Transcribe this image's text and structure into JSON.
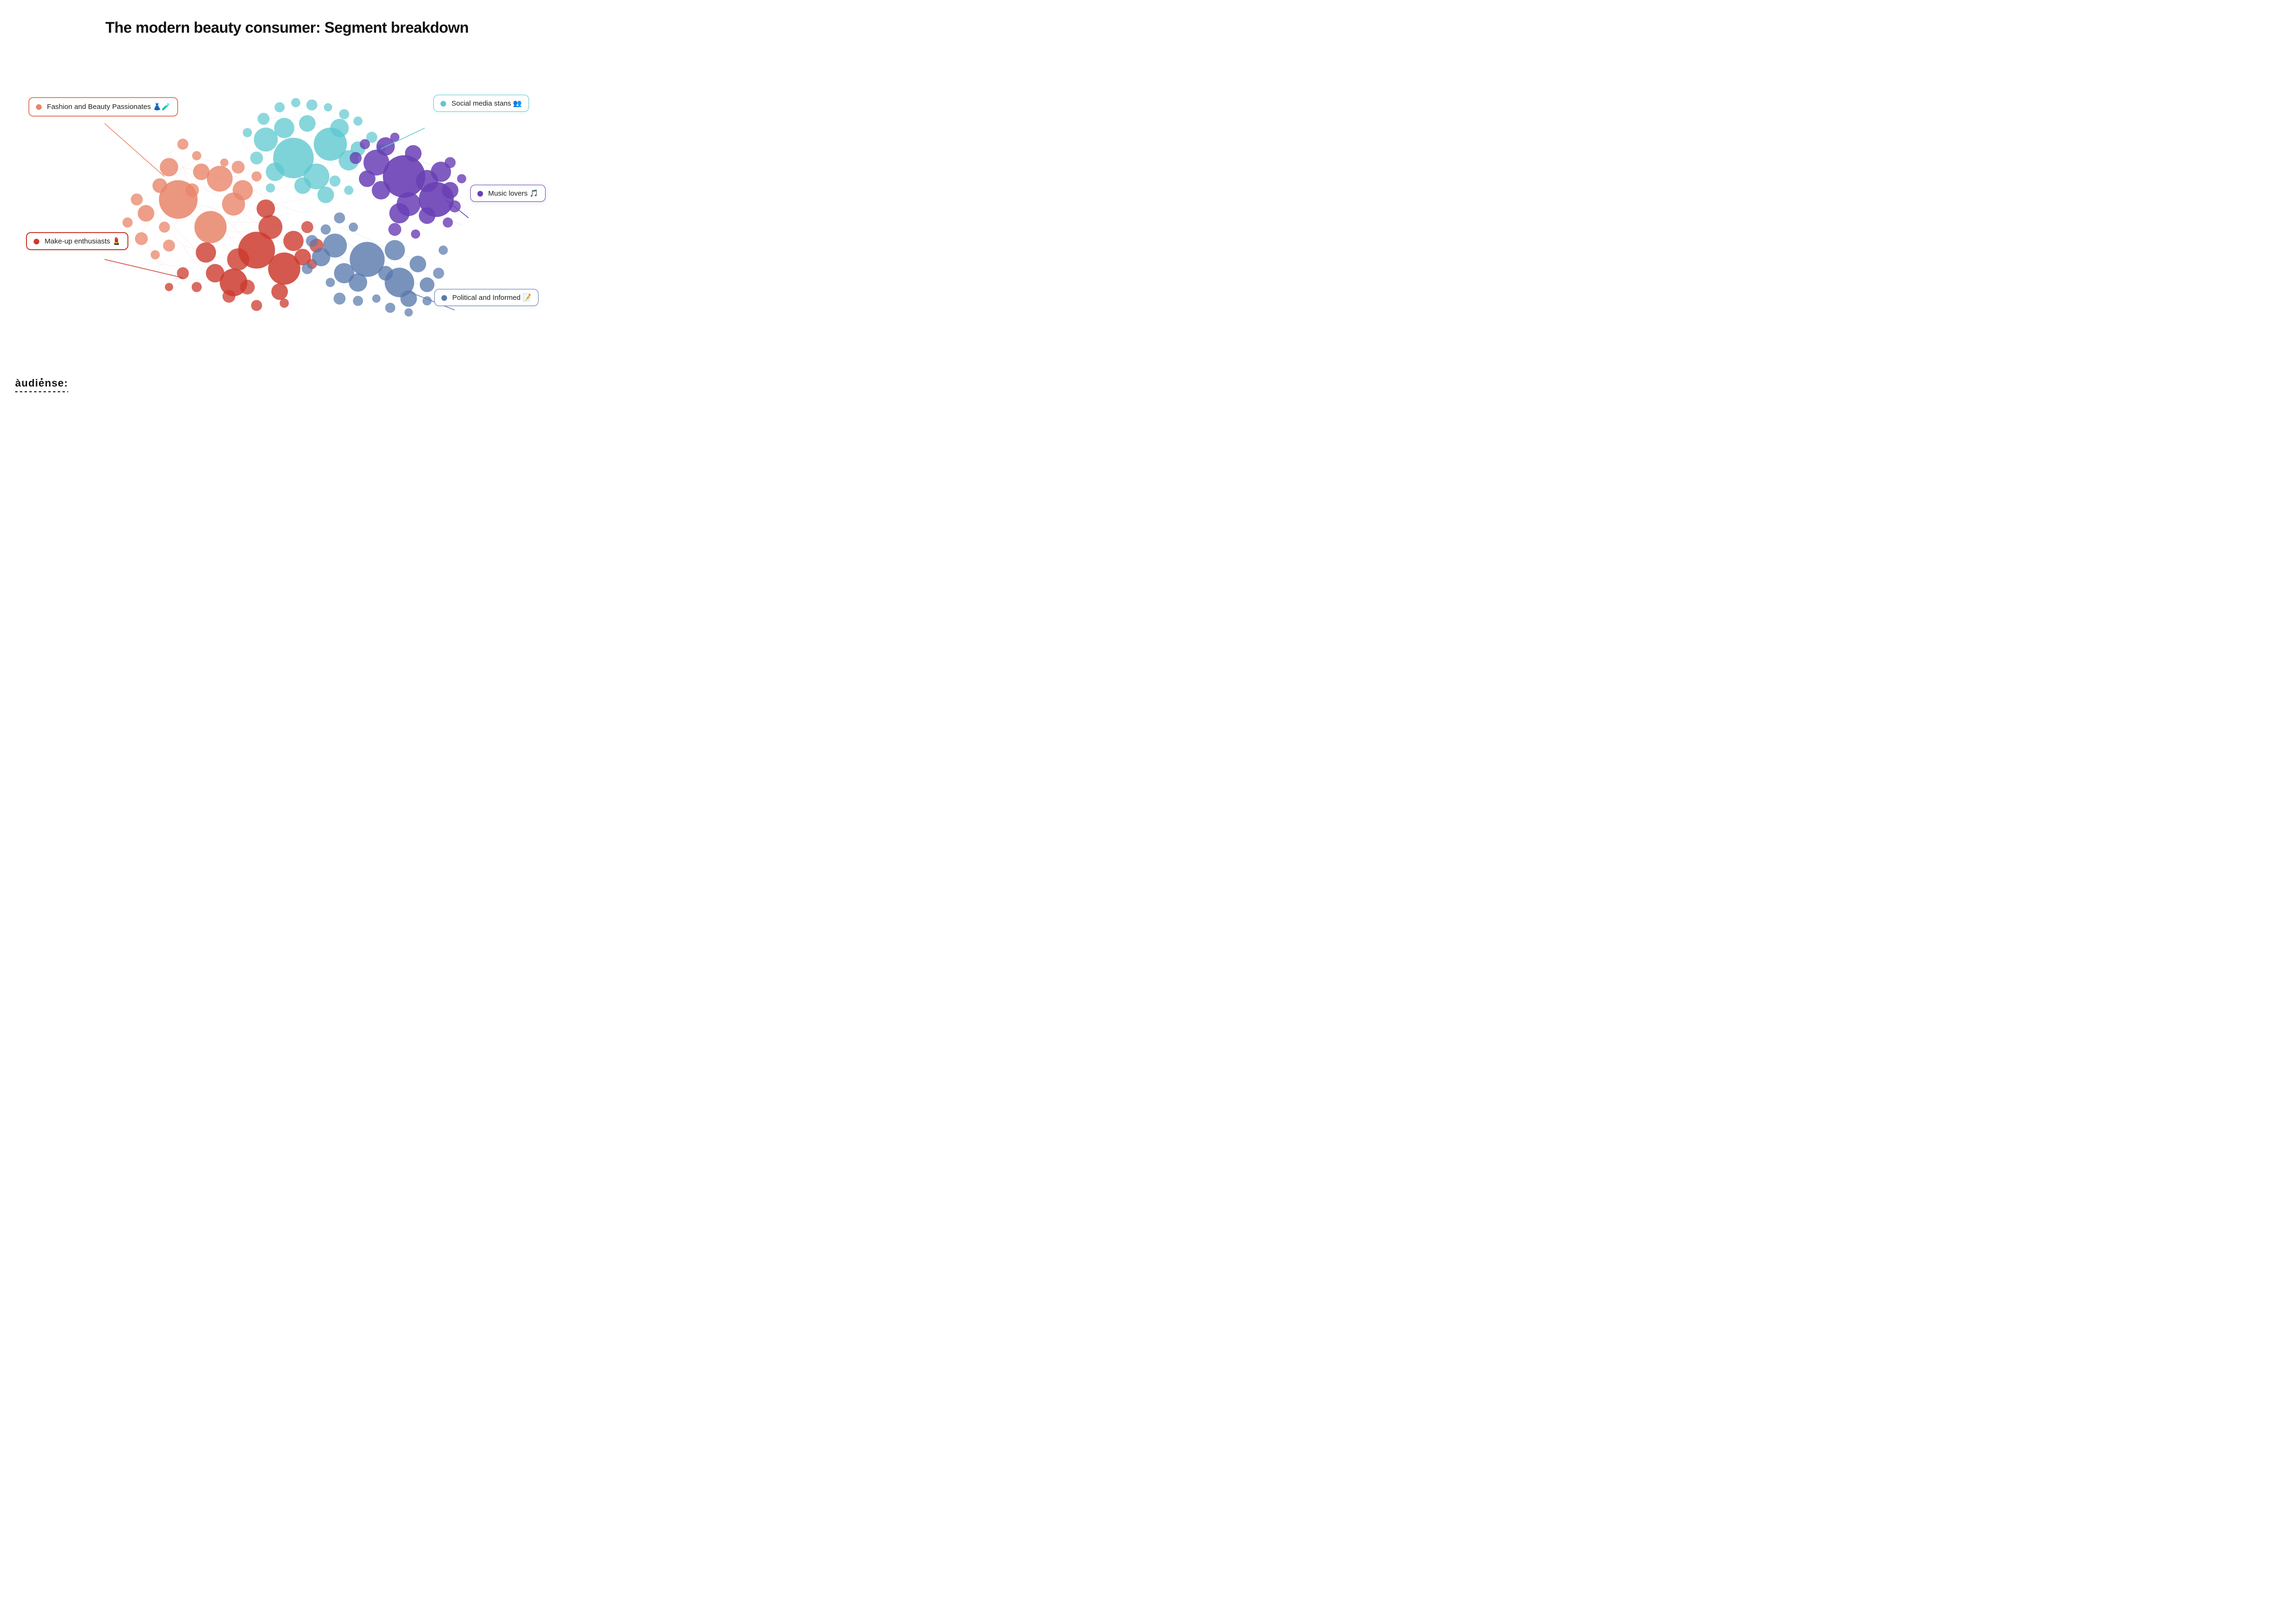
{
  "title": "The modern beauty consumer: Segment breakdown",
  "segments": [
    {
      "id": "fashion-beauty",
      "label": "Fashion and Beauty Passionates 👗🧪",
      "color": "#e8856a",
      "type": "salmon"
    },
    {
      "id": "makeup",
      "label": "Make-up enthusiasts 💄",
      "color": "#cc3b2e",
      "type": "red"
    },
    {
      "id": "social-media",
      "label": "Social media stans 👥",
      "color": "#5ec8cf",
      "type": "teal"
    },
    {
      "id": "music-lovers",
      "label": "Music lovers 🎵",
      "color": "#6a3fb5",
      "type": "purple"
    },
    {
      "id": "political",
      "label": "Political and Informed 📝",
      "color": "#5a7aad",
      "type": "blue"
    }
  ],
  "logo": {
    "text": "àudiense:"
  }
}
